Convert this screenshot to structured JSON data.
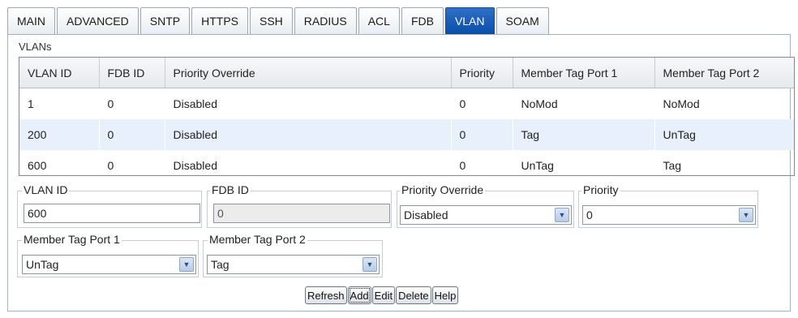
{
  "tabs": [
    "MAIN",
    "ADVANCED",
    "SNTP",
    "HTTPS",
    "SSH",
    "RADIUS",
    "ACL",
    "FDB",
    "VLAN",
    "SOAM"
  ],
  "active_tab": "VLAN",
  "vlans": {
    "legend": "VLANs",
    "columns": [
      "VLAN ID",
      "FDB ID",
      "Priority Override",
      "Priority",
      "Member Tag Port 1",
      "Member Tag Port 2"
    ],
    "rows": [
      [
        "1",
        "0",
        "Disabled",
        "0",
        "NoMod",
        "NoMod"
      ],
      [
        "200",
        "0",
        "Disabled",
        "0",
        "Tag",
        "UnTag"
      ],
      [
        "600",
        "0",
        "Disabled",
        "0",
        "UnTag",
        "Tag"
      ]
    ]
  },
  "form": {
    "vlan_id_label": "VLAN ID",
    "vlan_id_value": "600",
    "fdb_id_label": "FDB ID",
    "fdb_id_value": "0",
    "priority_override_label": "Priority Override",
    "priority_override_value": "Disabled",
    "priority_label": "Priority",
    "priority_value": "0",
    "member_tag_port1_label": "Member Tag Port 1",
    "member_tag_port1_value": "UnTag",
    "member_tag_port2_label": "Member Tag Port 2",
    "member_tag_port2_value": "Tag"
  },
  "buttons": {
    "refresh": "Refresh",
    "add": "Add",
    "edit": "Edit",
    "delete": "Delete",
    "help": "Help"
  }
}
